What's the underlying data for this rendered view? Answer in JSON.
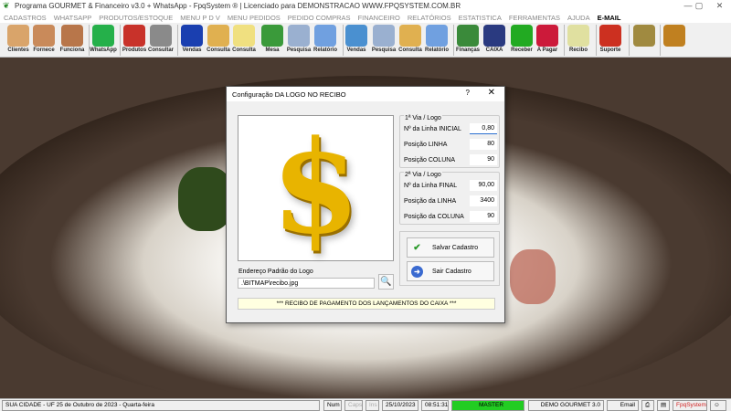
{
  "window": {
    "title": "Programa GOURMET & Financeiro v3.0 + WhatsApp - FpqSystem ® | Licenciado para  DEMONSTRACAO WWW.FPQSYSTEM.COM.BR",
    "minimize": "—",
    "maximize": "▢",
    "close": "✕"
  },
  "menu": [
    "CADASTROS",
    "WHATSAPP",
    "PRODUTOS/ESTOQUE",
    "MENU P D V",
    "MENU PEDIDOS",
    "PEDIDO COMPRAS",
    "FINANCEIRO",
    "RELATÓRIOS",
    "ESTATISTICA",
    "FERRAMENTAS",
    "AJUDA"
  ],
  "menu_email": "E-MAIL",
  "toolbar": [
    {
      "label": "Clientes",
      "icon": "clients-icon",
      "color": "#d9a46a"
    },
    {
      "label": "Fornece",
      "icon": "supplier-icon",
      "color": "#c98a5a"
    },
    {
      "label": "Funciona",
      "icon": "employee-icon",
      "color": "#b8764a"
    },
    {
      "label": "WhatsApp",
      "icon": "whatsapp-icon",
      "color": "#25b04a"
    },
    {
      "label": "Produtos",
      "icon": "products-icon",
      "color": "#c8322a"
    },
    {
      "label": "Consultar",
      "icon": "barcode-icon",
      "color": "#8a8a8a"
    },
    {
      "label": "Vendas",
      "icon": "pdv-icon",
      "color": "#1a3fb0"
    },
    {
      "label": "Consulta",
      "icon": "drawer-icon",
      "color": "#e0b050"
    },
    {
      "label": "Consulta",
      "icon": "receipt-icon",
      "color": "#f0e080"
    },
    {
      "label": "Mesa",
      "icon": "table-icon",
      "color": "#3a9a3a"
    },
    {
      "label": "Pesquisa",
      "icon": "search-doc-icon",
      "color": "#9ab0d0"
    },
    {
      "label": "Relatório",
      "icon": "printer-icon",
      "color": "#70a0e0"
    },
    {
      "label": "Vendas",
      "icon": "monitor-icon",
      "color": "#4a90d0"
    },
    {
      "label": "Pesquisa",
      "icon": "search-doc-icon",
      "color": "#9ab0d0"
    },
    {
      "label": "Consulta",
      "icon": "drawer-icon",
      "color": "#e0b050"
    },
    {
      "label": "Relatório",
      "icon": "printer-icon",
      "color": "#70a0e0"
    },
    {
      "label": "Finanças",
      "icon": "finance-icon",
      "color": "#3a8a3a"
    },
    {
      "label": "CAIXA",
      "icon": "cashbook-icon",
      "color": "#2a3a80"
    },
    {
      "label": "Receber",
      "icon": "receive-icon",
      "color": "#22aa22"
    },
    {
      "label": "A Pagar",
      "icon": "pay-icon",
      "color": "#cc1a3a"
    },
    {
      "label": "Recibo",
      "icon": "receipt-book-icon",
      "color": "#e0e0a0"
    },
    {
      "label": "Suporte",
      "icon": "support-icon",
      "color": "#cc3020"
    },
    {
      "label": "",
      "icon": "coin-icon",
      "color": "#a08a40"
    },
    {
      "label": "",
      "icon": "exit-icon",
      "color": "#c08020"
    }
  ],
  "dialog": {
    "title": "Configuração DA LOGO NO RECIBO",
    "help": "?",
    "close": "✕",
    "group1": {
      "title": "1ª Via / Logo",
      "rows": [
        {
          "label": "Nº da Linha INICIAL",
          "value": "0,80"
        },
        {
          "label": "Posição LINHA",
          "value": "80"
        },
        {
          "label": "Posição COLUNA",
          "value": "90"
        }
      ]
    },
    "group2": {
      "title": "2ª Via / Logo",
      "rows": [
        {
          "label": "Nº da Linha FINAL",
          "value": "90,00"
        },
        {
          "label": "Posição da LINHA",
          "value": "3400"
        },
        {
          "label": "Posição da COLUNA",
          "value": "90"
        }
      ]
    },
    "save": "Salvar Cadastro",
    "exit": "Sair Cadastro",
    "path_label": "Endereço Padrão do Logo",
    "path_value": ".\\BITMAP\\recibo.jpg",
    "footer": "*** RECIBO DE PAGAMENTO DOS LANÇAMENTOS DO CAIXA ***"
  },
  "status": {
    "city": "SUA CIDADE - UF 25 de Outubro de 2023 - Quarta-feira",
    "num": "Num",
    "caps": "Caps",
    "ins": "Ins",
    "date": "25/10/2023",
    "time": "08:51:31",
    "user": "MASTER",
    "company": "DEMO GOURMET 3.0",
    "email": "Email",
    "brand": "FpqSystem"
  }
}
